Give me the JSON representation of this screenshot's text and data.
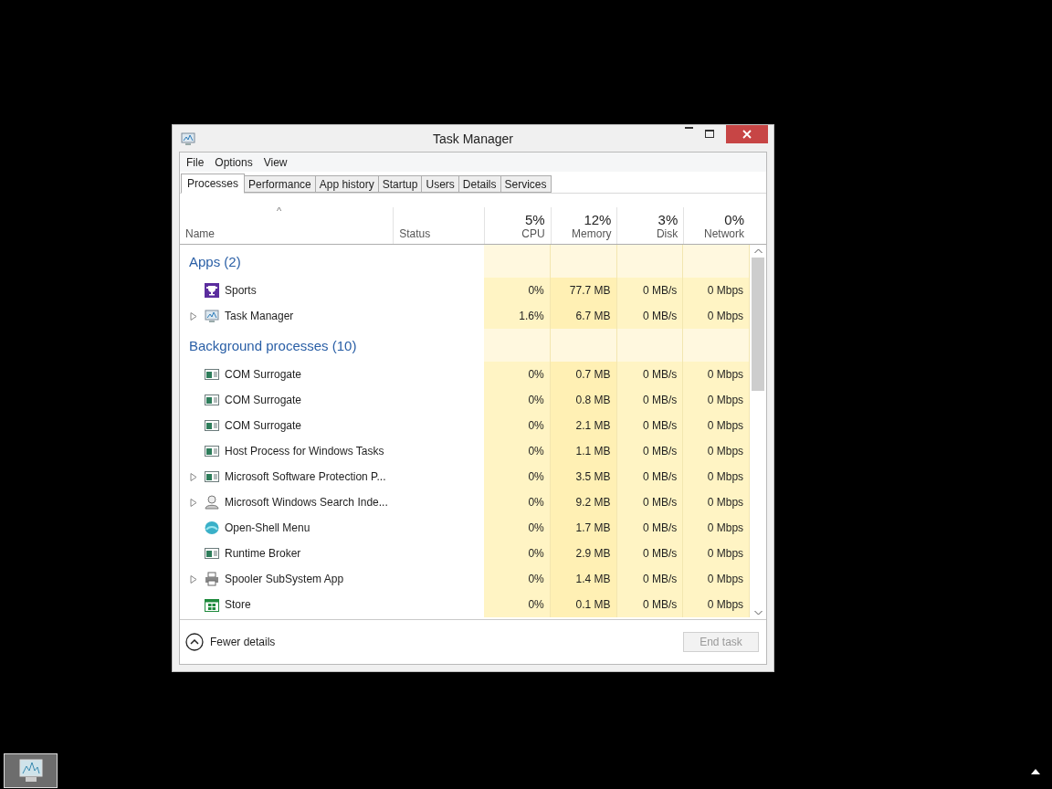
{
  "window": {
    "title": "Task Manager"
  },
  "menu": [
    "File",
    "Options",
    "View"
  ],
  "tabs": [
    {
      "label": "Processes",
      "selected": true
    },
    {
      "label": "Performance",
      "selected": false
    },
    {
      "label": "App history",
      "selected": false
    },
    {
      "label": "Startup",
      "selected": false
    },
    {
      "label": "Users",
      "selected": false
    },
    {
      "label": "Details",
      "selected": false
    },
    {
      "label": "Services",
      "selected": false
    }
  ],
  "table": {
    "sort_indicator": "^",
    "columns": [
      {
        "label": "Name"
      },
      {
        "label": "Status"
      },
      {
        "label": "CPU",
        "usage": "5%"
      },
      {
        "label": "Memory",
        "usage": "12%"
      },
      {
        "label": "Disk",
        "usage": "3%"
      },
      {
        "label": "Network",
        "usage": "0%"
      }
    ],
    "rows": [
      {
        "kind": "group",
        "label": "Apps (2)"
      },
      {
        "kind": "process",
        "expandable": false,
        "name": "Sports",
        "cpu": "0%",
        "memory": "77.7 MB",
        "disk": "0 MB/s",
        "network": "0 Mbps"
      },
      {
        "kind": "process",
        "expandable": true,
        "name": "Task Manager",
        "cpu": "1.6%",
        "memory": "6.7 MB",
        "disk": "0 MB/s",
        "network": "0 Mbps"
      },
      {
        "kind": "group",
        "label": "Background processes (10)"
      },
      {
        "kind": "process",
        "expandable": false,
        "name": "COM Surrogate",
        "cpu": "0%",
        "memory": "0.7 MB",
        "disk": "0 MB/s",
        "network": "0 Mbps"
      },
      {
        "kind": "process",
        "expandable": false,
        "name": "COM Surrogate",
        "cpu": "0%",
        "memory": "0.8 MB",
        "disk": "0 MB/s",
        "network": "0 Mbps"
      },
      {
        "kind": "process",
        "expandable": false,
        "name": "COM Surrogate",
        "cpu": "0%",
        "memory": "2.1 MB",
        "disk": "0 MB/s",
        "network": "0 Mbps"
      },
      {
        "kind": "process",
        "expandable": false,
        "name": "Host Process for Windows Tasks",
        "cpu": "0%",
        "memory": "1.1 MB",
        "disk": "0 MB/s",
        "network": "0 Mbps"
      },
      {
        "kind": "process",
        "expandable": true,
        "name": "Microsoft Software Protection P...",
        "cpu": "0%",
        "memory": "3.5 MB",
        "disk": "0 MB/s",
        "network": "0 Mbps"
      },
      {
        "kind": "process",
        "expandable": true,
        "name": "Microsoft Windows Search Inde...",
        "cpu": "0%",
        "memory": "9.2 MB",
        "disk": "0 MB/s",
        "network": "0 Mbps"
      },
      {
        "kind": "process",
        "expandable": false,
        "name": "Open-Shell Menu",
        "cpu": "0%",
        "memory": "1.7 MB",
        "disk": "0 MB/s",
        "network": "0 Mbps"
      },
      {
        "kind": "process",
        "expandable": false,
        "name": "Runtime Broker",
        "cpu": "0%",
        "memory": "2.9 MB",
        "disk": "0 MB/s",
        "network": "0 Mbps"
      },
      {
        "kind": "process",
        "expandable": true,
        "name": "Spooler SubSystem App",
        "cpu": "0%",
        "memory": "1.4 MB",
        "disk": "0 MB/s",
        "network": "0 Mbps"
      },
      {
        "kind": "process",
        "expandable": false,
        "name": "Store",
        "cpu": "0%",
        "memory": "0.1 MB",
        "disk": "0 MB/s",
        "network": "0 Mbps"
      }
    ]
  },
  "footer": {
    "toggle": "Fewer details",
    "button": {
      "label": "End task",
      "disabled": true
    }
  }
}
